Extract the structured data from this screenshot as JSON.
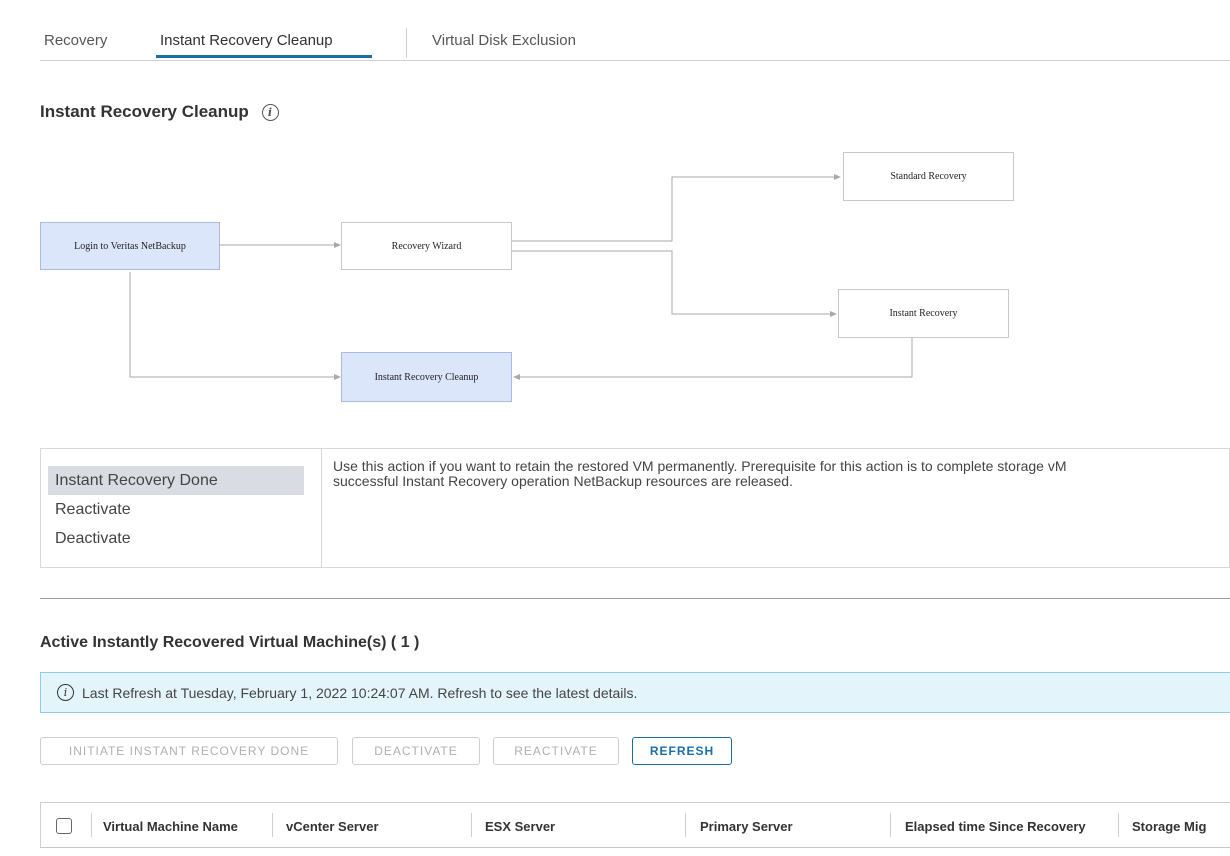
{
  "tabs": [
    {
      "label": "Recovery",
      "active": false
    },
    {
      "label": "Instant Recovery Cleanup",
      "active": true
    },
    {
      "label": "Virtual Disk Exclusion",
      "active": false
    }
  ],
  "section_title": "Instant Recovery Cleanup",
  "info_glyph": "i",
  "diagram": {
    "nodes": {
      "login": "Login to Veritas NetBackup",
      "wizard": "Recovery Wizard",
      "standard": "Standard Recovery",
      "instant": "Instant Recovery",
      "cleanup": "Instant Recovery Cleanup"
    }
  },
  "actions": {
    "items": [
      "Instant Recovery Done",
      "Reactivate",
      "Deactivate"
    ],
    "selected": "Instant Recovery Done",
    "description_line1": "Use this action if you want to retain the restored VM permanently. Prerequisite for this action is to complete storage vM",
    "description_line2": "successful Instant Recovery operation NetBackup resources are released."
  },
  "vm_section": {
    "title": "Active Instantly Recovered Virtual Machine(s) ( 1 )",
    "alert_text": "Last Refresh at Tuesday, February 1, 2022 10:24:07 AM. Refresh to see the latest details.",
    "buttons": {
      "initiate": "INITIATE INSTANT RECOVERY DONE",
      "deactivate": "DEACTIVATE",
      "reactivate": "REACTIVATE",
      "refresh": "REFRESH"
    },
    "columns": [
      "Virtual Machine Name",
      "vCenter Server",
      "ESX Server",
      "Primary Server",
      "Elapsed time Since Recovery",
      "Storage Mig"
    ]
  },
  "colors": {
    "accent": "#1b6ea8",
    "node_highlight": "#dce6fb",
    "alert_bg": "#e3f4fb",
    "alert_border": "#8dcdea"
  }
}
